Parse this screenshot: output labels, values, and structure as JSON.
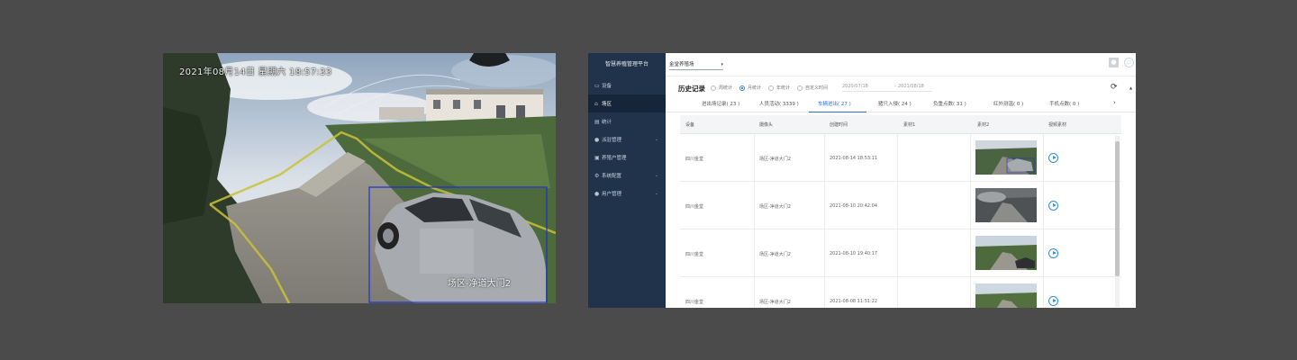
{
  "camera": {
    "timestamp": "2021年08月14日  星期六  18:57:33",
    "location_label": "场区-净道大门2"
  },
  "sidebar": {
    "title": "智慧养殖管理平台",
    "items": [
      {
        "label": "设备",
        "icon": "camera-icon"
      },
      {
        "label": "场区",
        "icon": "home-icon"
      },
      {
        "label": "统计",
        "icon": "chart-icon"
      },
      {
        "label": "派驻管理",
        "icon": "person-icon"
      },
      {
        "label": "养殖户管理",
        "icon": "calendar-icon"
      },
      {
        "label": "系统配置",
        "icon": "settings-icon"
      },
      {
        "label": "用户管理",
        "icon": "user-group-icon"
      }
    ]
  },
  "topbar": {
    "farm_select": "金堂养殖场"
  },
  "history": {
    "title": "历史记录",
    "radios": [
      "周统计",
      "月统计",
      "年统计",
      "自定义时间"
    ],
    "selected_radio": "月统计",
    "date_start": "2020/07/18",
    "date_sep": "-",
    "date_end": "2021/08/18"
  },
  "tabs": [
    "进出场记录( 23 )",
    "人员活动( 3339 )",
    "车辆进出( 27 )",
    "猪只入侵( 24 )",
    "负重点数( 31 )",
    "红外测温( 0 )",
    "手机点数( 0 )"
  ],
  "active_tab": "车辆进出( 27 )",
  "table": {
    "headers": [
      "设备",
      "摄像头",
      "创建时间",
      "素材1",
      "素材2",
      "视频素材"
    ],
    "rows": [
      {
        "device": "四川金堂",
        "camera": "场区-净道大门2",
        "time": "2021-08-14 18:53:11"
      },
      {
        "device": "四川金堂",
        "camera": "场区-净道大门2",
        "time": "2021-08-10 20:42:04"
      },
      {
        "device": "四川金堂",
        "camera": "场区-净道大门2",
        "time": "2021-08-10 19:40:17"
      },
      {
        "device": "四川金堂",
        "camera": "场区-净道大门2",
        "time": "2021-08-08 11:51:22"
      }
    ]
  }
}
